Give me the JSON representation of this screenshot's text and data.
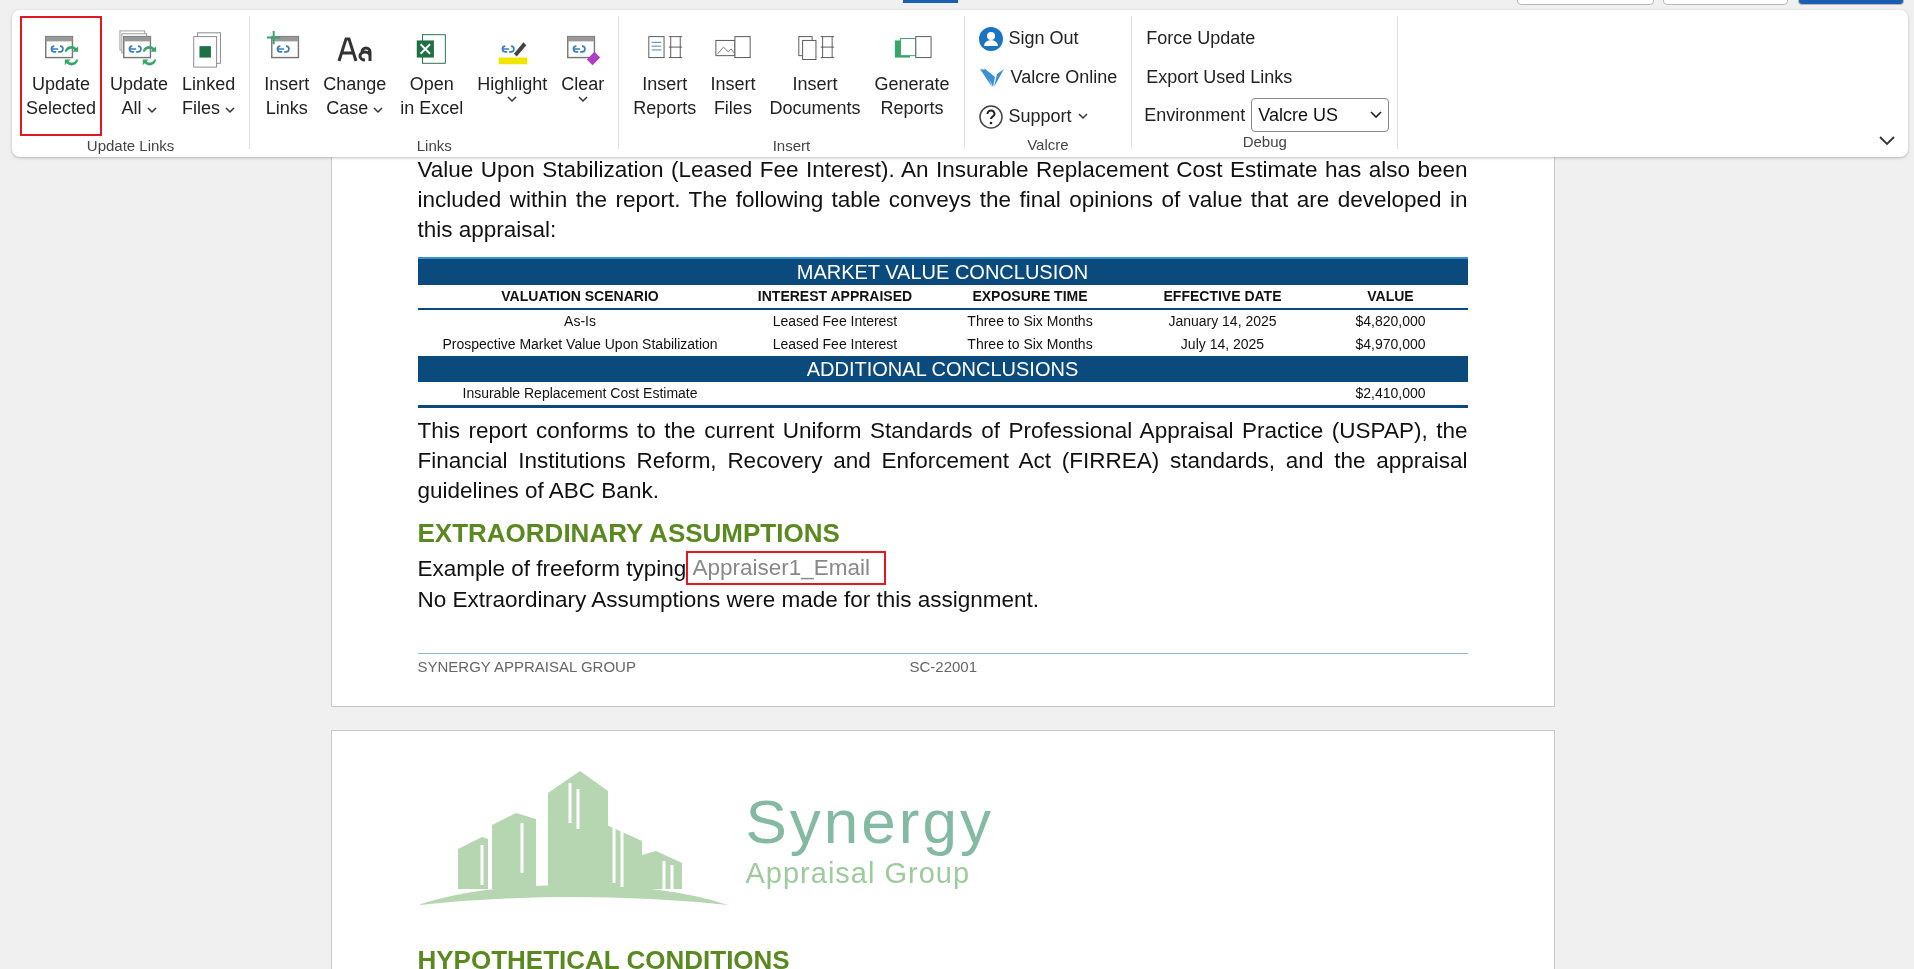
{
  "ribbon": {
    "groups": [
      {
        "label": "Update Links",
        "kind": "buttons",
        "buttons": [
          {
            "lines": [
              "Update",
              "Selected"
            ],
            "dropdown": false,
            "highlighted": true
          },
          {
            "lines": [
              "Update",
              "All"
            ],
            "dropdown": true,
            "highlighted": false
          },
          {
            "lines": [
              "Linked",
              "Files"
            ],
            "dropdown": true,
            "highlighted": false
          }
        ]
      },
      {
        "label": "Links",
        "kind": "buttons",
        "buttons": [
          {
            "lines": [
              "Insert",
              "Links"
            ],
            "dropdown": false,
            "highlighted": false
          },
          {
            "lines": [
              "Change",
              "Case"
            ],
            "dropdown": true,
            "highlighted": false
          },
          {
            "lines": [
              "Open",
              "in Excel"
            ],
            "dropdown": false,
            "highlighted": false
          },
          {
            "lines": [
              "Highlight"
            ],
            "dropdown": true,
            "highlighted": false
          },
          {
            "lines": [
              "Clear"
            ],
            "dropdown": true,
            "highlighted": false
          }
        ]
      },
      {
        "label": "Insert",
        "kind": "buttons",
        "buttons": [
          {
            "lines": [
              "Insert",
              "Reports"
            ],
            "dropdown": false,
            "highlighted": false
          },
          {
            "lines": [
              "Insert",
              "Files"
            ],
            "dropdown": false,
            "highlighted": false
          },
          {
            "lines": [
              "Insert",
              "Documents"
            ],
            "dropdown": false,
            "highlighted": false
          },
          {
            "lines": [
              "Generate",
              "Reports"
            ],
            "dropdown": false,
            "highlighted": false
          }
        ]
      },
      {
        "label": "Valcre",
        "kind": "list",
        "items": [
          {
            "label": "Sign Out",
            "dropdown": false
          },
          {
            "label": "Valcre Online",
            "dropdown": false
          },
          {
            "label": "Support",
            "dropdown": true
          }
        ]
      },
      {
        "label": "Debug",
        "kind": "debug",
        "items": [
          {
            "label": "Force Update"
          },
          {
            "label": "Export Used Links"
          }
        ],
        "environment": {
          "label": "Environment",
          "value": "Valcre US"
        }
      }
    ]
  },
  "document": {
    "intro": [
      "Value Upon Stabilization (Leased Fee Interest). An Insurable Replacement Cost Estimate has also been included within the report. The following table conveys the final opinions of value that are developed in this appraisal:"
    ],
    "table": {
      "title": "MARKET VALUE CONCLUSION",
      "columns": [
        "VALUATION SCENARIO",
        "INTEREST APPRAISED",
        "EXPOSURE TIME",
        "EFFECTIVE DATE",
        "VALUE"
      ],
      "rows": [
        [
          "As-Is",
          "Leased Fee Interest",
          "Three to Six Months",
          "January 14, 2025",
          "$4,820,000"
        ],
        [
          "Prospective Market Value Upon Stabilization",
          "Leased Fee Interest",
          "Three to Six Months",
          "July 14, 2025",
          "$4,970,000"
        ]
      ],
      "section": "ADDITIONAL CONCLUSIONS",
      "extra_rows": [
        [
          "Insurable Replacement Cost Estimate",
          "",
          "",
          "",
          "$2,410,000"
        ]
      ]
    },
    "conformance": "This report conforms to the current Uniform Standards of Professional Appraisal Practice (USPAP), the Financial Institutions Reform, Recovery and Enforcement Act (FIRREA) standards, and the appraisal guidelines of ABC Bank.",
    "heading": "EXTRAORDINARY ASSUMPTIONS",
    "freeform": {
      "text": "Example of freeform typing",
      "field": {
        "placeholder": "Appraiser1_Email",
        "highlighted": true
      }
    },
    "assumptions": "No Extraordinary Assumptions were made for this assignment.",
    "footer": {
      "left": "SYNERGY APPRAISAL GROUP",
      "center": "SC-22001"
    },
    "page2": {
      "logo": {
        "name": "Synergy",
        "tagline": "Appraisal Group"
      },
      "heading": "HYPOTHETICAL CONDITIONS"
    }
  }
}
